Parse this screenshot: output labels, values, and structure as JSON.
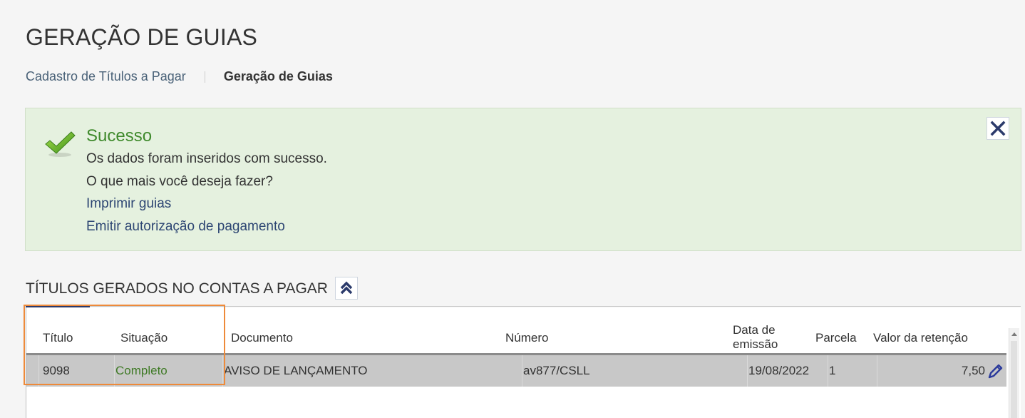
{
  "page": {
    "title": "GERAÇÃO DE GUIAS"
  },
  "breadcrumb": {
    "link": "Cadastro de Títulos a Pagar",
    "current": "Geração de Guias"
  },
  "alert": {
    "title": "Sucesso",
    "message": "Os dados foram inseridos com sucesso.",
    "question": "O que mais você deseja fazer?",
    "actions": [
      "Imprimir guias",
      "Emitir autorização de pagamento"
    ],
    "close_icon": "close-x"
  },
  "section": {
    "title": "TÍTULOS GERADOS NO CONTAS A PAGAR",
    "collapse_icon": "double-chevron-up"
  },
  "table": {
    "headers": {
      "titulo": "Título",
      "situacao": "Situação",
      "documento": "Documento",
      "numero": "Número",
      "data_emissao_1": "Data de",
      "data_emissao_2": "emissão",
      "parcela": "Parcela",
      "valor_retencao": "Valor da retenção"
    },
    "rows": [
      {
        "titulo": "9098",
        "situacao": "Completo",
        "documento": "AVISO DE LANÇAMENTO",
        "numero": "av877/CSLL",
        "data_emissao": "19/08/2022",
        "parcela": "1",
        "valor_retencao": "7,50"
      }
    ]
  },
  "colors": {
    "alert_bg": "#e5f1df",
    "success_green": "#3f8a2c",
    "link_blue": "#2d4673",
    "highlight_orange": "#ee8a3a",
    "selected_row": "#c8c8c8"
  }
}
